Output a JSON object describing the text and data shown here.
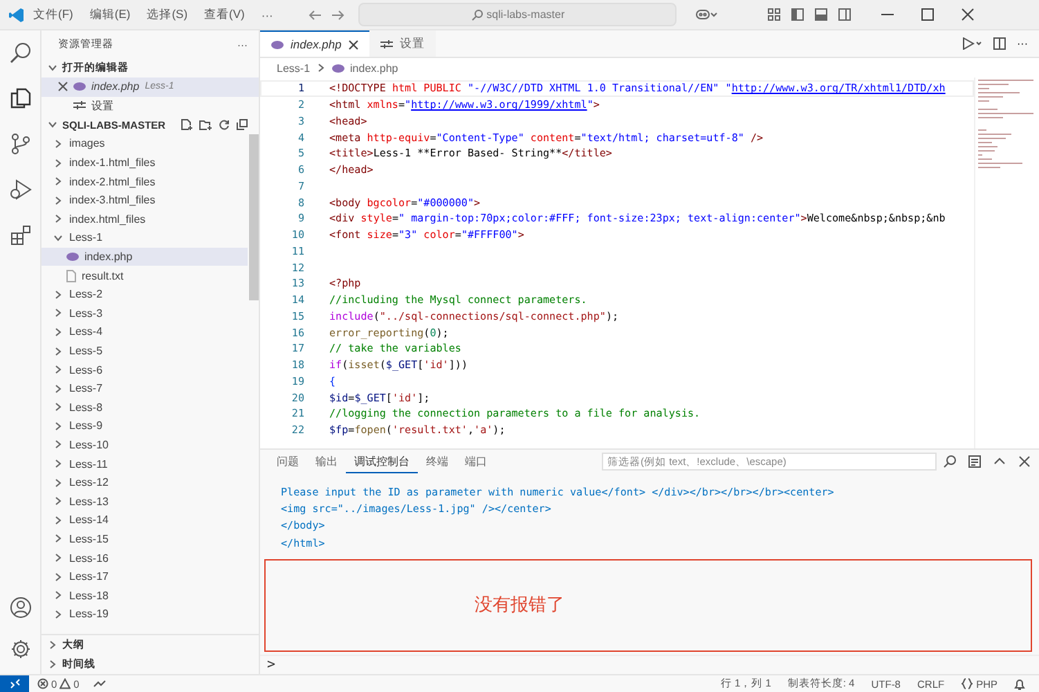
{
  "title_bar": {
    "menus": [
      "文件(F)",
      "编辑(E)",
      "选择(S)",
      "查看(V)",
      "···"
    ],
    "search": "sqli-labs-master"
  },
  "sidebar": {
    "title": "资源管理器",
    "more": "···",
    "open_editors": {
      "label": "打开的编辑器",
      "expanded": true,
      "items": [
        {
          "name": "index.php",
          "hint": "Less-1",
          "kind": "php",
          "selected": true
        },
        {
          "name": "设置",
          "kind": "settings",
          "selected": false
        }
      ]
    },
    "folder": {
      "label": "SQLI-LABS-MASTER",
      "expanded": true,
      "items": [
        {
          "name": "images",
          "kind": "folder",
          "expanded": false,
          "selected": false
        },
        {
          "name": "index-1.html_files",
          "kind": "folder",
          "expanded": false,
          "selected": false
        },
        {
          "name": "index-2.html_files",
          "kind": "folder",
          "expanded": false,
          "selected": false
        },
        {
          "name": "index-3.html_files",
          "kind": "folder",
          "expanded": false,
          "selected": false
        },
        {
          "name": "index.html_files",
          "kind": "folder",
          "expanded": false,
          "selected": false
        },
        {
          "name": "Less-1",
          "kind": "folder",
          "expanded": true,
          "selected": false,
          "children": [
            {
              "name": "index.php",
              "kind": "php",
              "selected": true
            },
            {
              "name": "result.txt",
              "kind": "text",
              "selected": false
            }
          ]
        },
        {
          "name": "Less-2",
          "kind": "folder",
          "expanded": false,
          "selected": false
        },
        {
          "name": "Less-3",
          "kind": "folder",
          "expanded": false,
          "selected": false
        },
        {
          "name": "Less-4",
          "kind": "folder",
          "expanded": false,
          "selected": false
        },
        {
          "name": "Less-5",
          "kind": "folder",
          "expanded": false,
          "selected": false
        },
        {
          "name": "Less-6",
          "kind": "folder",
          "expanded": false,
          "selected": false
        },
        {
          "name": "Less-7",
          "kind": "folder",
          "expanded": false,
          "selected": false
        },
        {
          "name": "Less-8",
          "kind": "folder",
          "expanded": false,
          "selected": false
        },
        {
          "name": "Less-9",
          "kind": "folder",
          "expanded": false,
          "selected": false
        },
        {
          "name": "Less-10",
          "kind": "folder",
          "expanded": false,
          "selected": false
        },
        {
          "name": "Less-11",
          "kind": "folder",
          "expanded": false,
          "selected": false
        },
        {
          "name": "Less-12",
          "kind": "folder",
          "expanded": false,
          "selected": false
        },
        {
          "name": "Less-13",
          "kind": "folder",
          "expanded": false,
          "selected": false
        },
        {
          "name": "Less-14",
          "kind": "folder",
          "expanded": false,
          "selected": false
        },
        {
          "name": "Less-15",
          "kind": "folder",
          "expanded": false,
          "selected": false
        },
        {
          "name": "Less-16",
          "kind": "folder",
          "expanded": false,
          "selected": false
        },
        {
          "name": "Less-17",
          "kind": "folder",
          "expanded": false,
          "selected": false
        },
        {
          "name": "Less-18",
          "kind": "folder",
          "expanded": false,
          "selected": false
        },
        {
          "name": "Less-19",
          "kind": "folder",
          "expanded": false,
          "selected": false
        }
      ]
    },
    "sections": [
      {
        "label": "大纲",
        "expanded": false
      },
      {
        "label": "时间线",
        "expanded": false
      }
    ]
  },
  "editor": {
    "tabs": [
      {
        "label": "index.php",
        "kind": "php",
        "preview": true,
        "selected": true
      },
      {
        "label": "设置",
        "kind": "settings",
        "preview": false,
        "selected": false
      }
    ],
    "actions_more": "···",
    "breadcrumb": [
      "Less-1",
      "index.php"
    ],
    "lines": [
      {
        "number": "1",
        "current": true,
        "tokens": [
          {
            "kind": "tag",
            "text": "<!DOCTYPE"
          },
          {
            "kind": "attr",
            "text": " html PUBLIC "
          },
          {
            "kind": "str",
            "text": "\"-//W3C//DTD XHTML 1.0 Transitional//EN\" \""
          },
          {
            "kind": "link",
            "text": "http://www.w3.org/TR/xhtml1/DTD/xh"
          }
        ]
      },
      {
        "number": "2",
        "current": false,
        "tokens": [
          {
            "kind": "tag",
            "text": "<html"
          },
          {
            "kind": "attr",
            "text": " xmlns"
          },
          {
            "kind": "text",
            "text": "="
          },
          {
            "kind": "str",
            "text": "\""
          },
          {
            "kind": "link",
            "text": "http://www.w3.org/1999/xhtml"
          },
          {
            "kind": "str",
            "text": "\""
          },
          {
            "kind": "tag",
            "text": ">"
          }
        ]
      },
      {
        "number": "3",
        "current": false,
        "tokens": [
          {
            "kind": "tag",
            "text": "<head>"
          }
        ]
      },
      {
        "number": "4",
        "current": false,
        "tokens": [
          {
            "kind": "tag",
            "text": "<meta"
          },
          {
            "kind": "attr",
            "text": " http-equiv"
          },
          {
            "kind": "text",
            "text": "="
          },
          {
            "kind": "str",
            "text": "\"Content-Type\""
          },
          {
            "kind": "attr",
            "text": " content"
          },
          {
            "kind": "text",
            "text": "="
          },
          {
            "kind": "str",
            "text": "\"text/html; charset=utf-8\""
          },
          {
            "kind": "tag",
            "text": " />"
          }
        ]
      },
      {
        "number": "5",
        "current": false,
        "tokens": [
          {
            "kind": "tag",
            "text": "<title>"
          },
          {
            "kind": "text",
            "text": "Less-1 **Error Based- String**"
          },
          {
            "kind": "tag",
            "text": "</title>"
          }
        ]
      },
      {
        "number": "6",
        "current": false,
        "tokens": [
          {
            "kind": "tag",
            "text": "</head>"
          }
        ]
      },
      {
        "number": "7",
        "current": false
      },
      {
        "number": "8",
        "current": false,
        "tokens": [
          {
            "kind": "tag",
            "text": "<body"
          },
          {
            "kind": "attr",
            "text": " bgcolor"
          },
          {
            "kind": "text",
            "text": "="
          },
          {
            "kind": "str",
            "text": "\"#000000\""
          },
          {
            "kind": "tag",
            "text": ">"
          }
        ]
      },
      {
        "number": "9",
        "current": false,
        "tokens": [
          {
            "kind": "tag",
            "text": "<div"
          },
          {
            "kind": "attr",
            "text": " style"
          },
          {
            "kind": "text",
            "text": "="
          },
          {
            "kind": "str",
            "text": "\" margin-top:70px;color:#FFF; font-size:23px; text-align:center\""
          },
          {
            "kind": "tag",
            "text": ">"
          },
          {
            "kind": "text",
            "text": "Welcome&nbsp;&nbsp;&nb"
          }
        ]
      },
      {
        "number": "10",
        "current": false,
        "tokens": [
          {
            "kind": "tag",
            "text": "<font"
          },
          {
            "kind": "attr",
            "text": " size"
          },
          {
            "kind": "text",
            "text": "="
          },
          {
            "kind": "str",
            "text": "\"3\""
          },
          {
            "kind": "attr",
            "text": " color"
          },
          {
            "kind": "text",
            "text": "="
          },
          {
            "kind": "str",
            "text": "\"#FFFF00\""
          },
          {
            "kind": "tag",
            "text": ">"
          }
        ]
      },
      {
        "number": "11",
        "current": false
      },
      {
        "number": "12",
        "current": false
      },
      {
        "number": "13",
        "current": false,
        "tokens": [
          {
            "kind": "tag",
            "text": "<?php"
          }
        ]
      },
      {
        "number": "14",
        "current": false,
        "tokens": [
          {
            "kind": "comment",
            "text": "//including the Mysql connect parameters."
          }
        ]
      },
      {
        "number": "15",
        "current": false,
        "tokens": [
          {
            "kind": "kw",
            "text": "include"
          },
          {
            "kind": "text",
            "text": "("
          },
          {
            "kind": "strdark",
            "text": "\"../sql-connections/sql-connect.php\""
          },
          {
            "kind": "text",
            "text": ");"
          }
        ]
      },
      {
        "number": "16",
        "current": false,
        "tokens": [
          {
            "kind": "fn",
            "text": "error_reporting"
          },
          {
            "kind": "text",
            "text": "("
          },
          {
            "kind": "num",
            "text": "0"
          },
          {
            "kind": "text",
            "text": ");"
          }
        ]
      },
      {
        "number": "17",
        "current": false,
        "tokens": [
          {
            "kind": "comment",
            "text": "// take the variables"
          }
        ]
      },
      {
        "number": "18",
        "current": false,
        "tokens": [
          {
            "kind": "kw",
            "text": "if"
          },
          {
            "kind": "text",
            "text": "("
          },
          {
            "kind": "fn",
            "text": "isset"
          },
          {
            "kind": "text",
            "text": "("
          },
          {
            "kind": "var",
            "text": "$_GET"
          },
          {
            "kind": "text",
            "text": "["
          },
          {
            "kind": "strdark",
            "text": "'id'"
          },
          {
            "kind": "text",
            "text": "]))"
          }
        ]
      },
      {
        "number": "19",
        "current": false,
        "tokens": [
          {
            "kind": "brace",
            "text": "{"
          }
        ]
      },
      {
        "number": "20",
        "current": false,
        "tokens": [
          {
            "kind": "var",
            "text": "$id"
          },
          {
            "kind": "text",
            "text": "="
          },
          {
            "kind": "var",
            "text": "$_GET"
          },
          {
            "kind": "text",
            "text": "["
          },
          {
            "kind": "strdark",
            "text": "'id'"
          },
          {
            "kind": "text",
            "text": "];"
          }
        ]
      },
      {
        "number": "21",
        "current": false,
        "tokens": [
          {
            "kind": "comment",
            "text": "//logging the connection parameters to a file for analysis."
          }
        ]
      },
      {
        "number": "22",
        "current": false,
        "tokens": [
          {
            "kind": "var",
            "text": "$fp"
          },
          {
            "kind": "text",
            "text": "="
          },
          {
            "kind": "fn",
            "text": "fopen"
          },
          {
            "kind": "text",
            "text": "("
          },
          {
            "kind": "strdark",
            "text": "'result.txt'"
          },
          {
            "kind": "text",
            "text": ","
          },
          {
            "kind": "strdark",
            "text": "'a'"
          },
          {
            "kind": "text",
            "text": ");"
          }
        ]
      }
    ]
  },
  "panel": {
    "tabs": [
      {
        "label": "问题",
        "selected": false
      },
      {
        "label": "输出",
        "selected": false
      },
      {
        "label": "调试控制台",
        "selected": true
      },
      {
        "label": "终端",
        "selected": false
      },
      {
        "label": "端口",
        "selected": false
      }
    ],
    "filter": {
      "placeholder": "筛选器(例如 text、!exclude、\\escape)"
    },
    "output": [
      "Please input the ID as parameter with numeric value</font> </div></br></br></br><center>",
      "<img src=\"../images/Less-1.jpg\" /></center>",
      "</body>",
      "</html>"
    ],
    "note": "没有报错了",
    "prompt": ">"
  },
  "status_bar": {
    "errors": "0",
    "warnings": "0",
    "position": "行 1，列 1",
    "tab_size": "制表符长度: 4",
    "encoding": "UTF-8",
    "eol": "CRLF",
    "language": "PHP"
  }
}
